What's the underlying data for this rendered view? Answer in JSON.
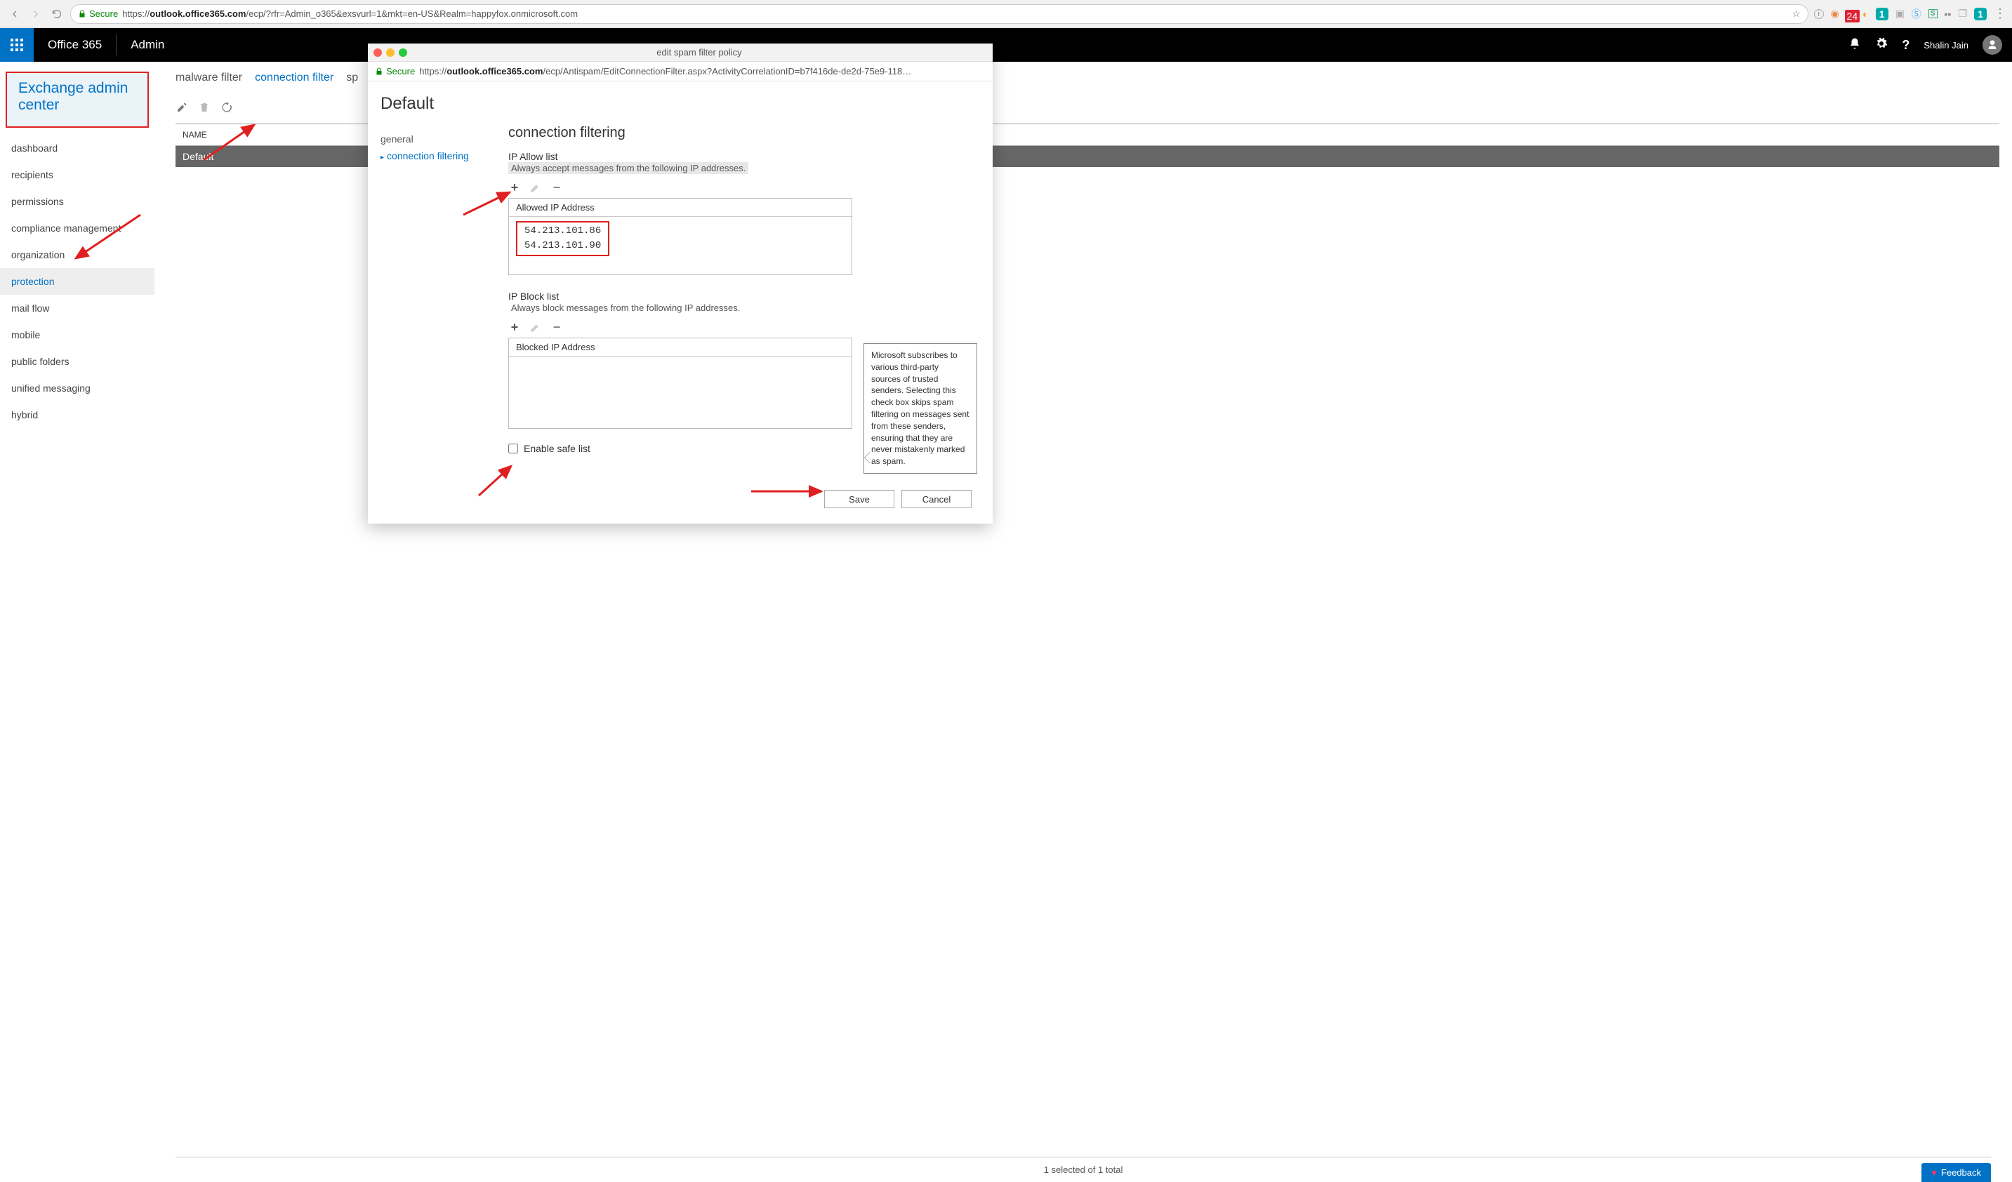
{
  "chrome": {
    "secure_label": "Secure",
    "url_host": "https://",
    "url_base": "outlook.office365.com",
    "url_path": "/ecp/?rfr=Admin_o365&exsvurl=1&mkt=en-US&Realm=happyfox.onmicrosoft.com",
    "ext_badge_1": "24",
    "teal_badge_1": "1",
    "teal_badge_2": "1"
  },
  "header": {
    "brand": "Office 365",
    "app": "Admin",
    "user_name": "Shalin Jain"
  },
  "eac": {
    "title": "Exchange admin center",
    "nav": [
      {
        "label": "dashboard"
      },
      {
        "label": "recipients"
      },
      {
        "label": "permissions"
      },
      {
        "label": "compliance management"
      },
      {
        "label": "organization"
      },
      {
        "label": "protection"
      },
      {
        "label": "mail flow"
      },
      {
        "label": "mobile"
      },
      {
        "label": "public folders"
      },
      {
        "label": "unified messaging"
      },
      {
        "label": "hybrid"
      }
    ],
    "tabs": {
      "malware": "malware filter",
      "conn": "connection filter",
      "sp": "sp"
    },
    "table_header": "NAME",
    "row0": "Default",
    "status": "1 selected of 1 total"
  },
  "popup": {
    "title": "edit spam filter policy",
    "secure_label": "Secure",
    "url_host": "https://",
    "url_base": "outlook.office365.com",
    "url_path": "/ecp/Antispam/EditConnectionFilter.aspx?ActivityCorrelationID=b7f416de-de2d-75e9-118…",
    "heading": "Default",
    "leftnav_general": "general",
    "leftnav_conn": "connection filtering",
    "section_title": "connection filtering",
    "allow_label": "IP Allow list",
    "allow_help": "Always accept messages from the following IP addresses.",
    "allow_header": "Allowed IP Address",
    "allow_ips": [
      "54.213.101.86",
      "54.213.101.90"
    ],
    "block_label": "IP Block list",
    "block_help": "Always block messages from the following IP addresses.",
    "block_header": "Blocked IP Address",
    "safe_label": "Enable safe list",
    "callout": "Microsoft subscribes to various third-party sources of trusted senders. Selecting this check box skips spam filtering on messages sent from these senders, ensuring that they are never mistakenly marked as spam.",
    "save": "Save",
    "cancel": "Cancel"
  },
  "feedback": {
    "label": "Feedback"
  }
}
